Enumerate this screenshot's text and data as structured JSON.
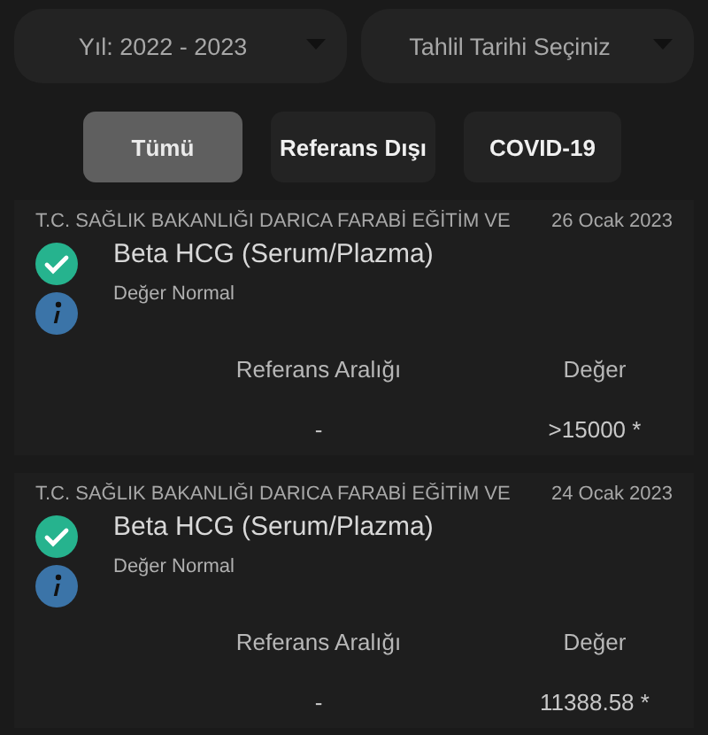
{
  "filters": [
    {
      "label": "Yıl: 2022 - 2023"
    },
    {
      "label": "Tahlil Tarihi Seçiniz"
    }
  ],
  "tabs": [
    {
      "label": "Tümü",
      "selected": true
    },
    {
      "label": "Referans Dışı",
      "selected": false
    },
    {
      "label": "COVID-19",
      "selected": false
    }
  ],
  "results": [
    {
      "institution": "T.C. SAĞLIK BAKANLIĞI DARICA FARABİ EĞİTİM VE",
      "date": "26 Ocak 2023",
      "test": "Beta HCG (Serum/Plazma)",
      "status": "Değer Normal",
      "range_label": "Referans Aralığı",
      "value_label": "Değer",
      "range": "-",
      "value": ">15000 *"
    },
    {
      "institution": "T.C. SAĞLIK BAKANLIĞI DARICA FARABİ EĞİTİM VE",
      "date": "24 Ocak 2023",
      "test": "Beta HCG (Serum/Plazma)",
      "status": "Değer Normal",
      "range_label": "Referans Aralığı",
      "value_label": "Değer",
      "range": "-",
      "value": "11388.58 *"
    }
  ]
}
